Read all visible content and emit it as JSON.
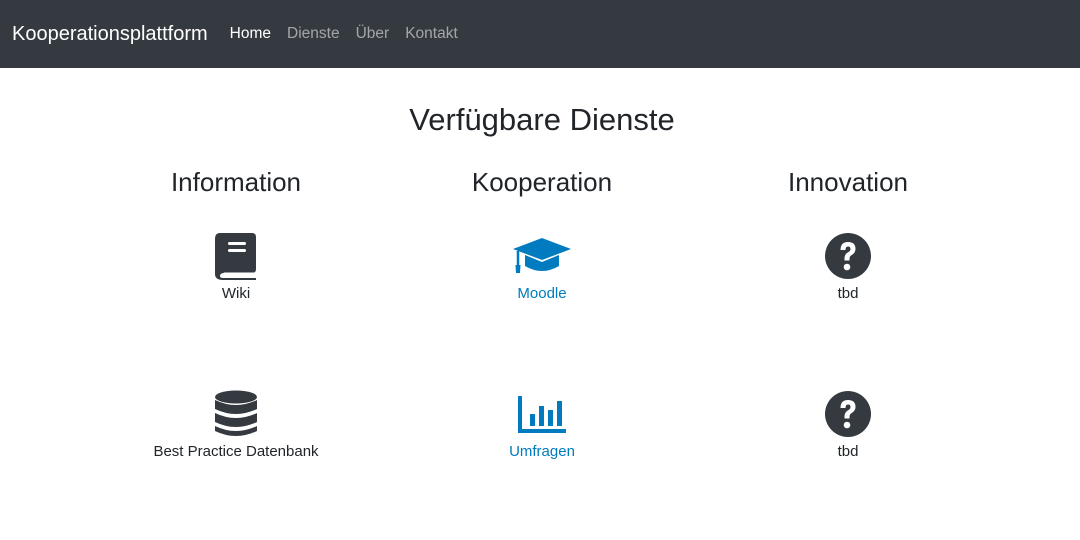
{
  "navbar": {
    "brand": "Kooperationsplattform",
    "links": [
      {
        "label": "Home",
        "active": true
      },
      {
        "label": "Dienste",
        "active": false
      },
      {
        "label": "Über",
        "active": false
      },
      {
        "label": "Kontakt",
        "active": false
      }
    ]
  },
  "main": {
    "title": "Verfügbare Dienste",
    "columns": [
      {
        "heading": "Information",
        "services": [
          {
            "label": "Wiki",
            "icon": "book-icon",
            "link": false
          },
          {
            "label": "Best Practice Datenbank",
            "icon": "database-icon",
            "link": false
          }
        ]
      },
      {
        "heading": "Kooperation",
        "services": [
          {
            "label": "Moodle",
            "icon": "graduation-cap-icon",
            "link": true
          },
          {
            "label": "Umfragen",
            "icon": "bar-chart-icon",
            "link": true
          }
        ]
      },
      {
        "heading": "Innovation",
        "services": [
          {
            "label": "tbd",
            "icon": "question-circle-icon",
            "link": false
          },
          {
            "label": "tbd",
            "icon": "question-circle-icon",
            "link": false
          }
        ]
      }
    ]
  },
  "colors": {
    "navbar_bg": "#343a40",
    "link_blue": "#007bbf",
    "icon_dark": "#343a40"
  }
}
